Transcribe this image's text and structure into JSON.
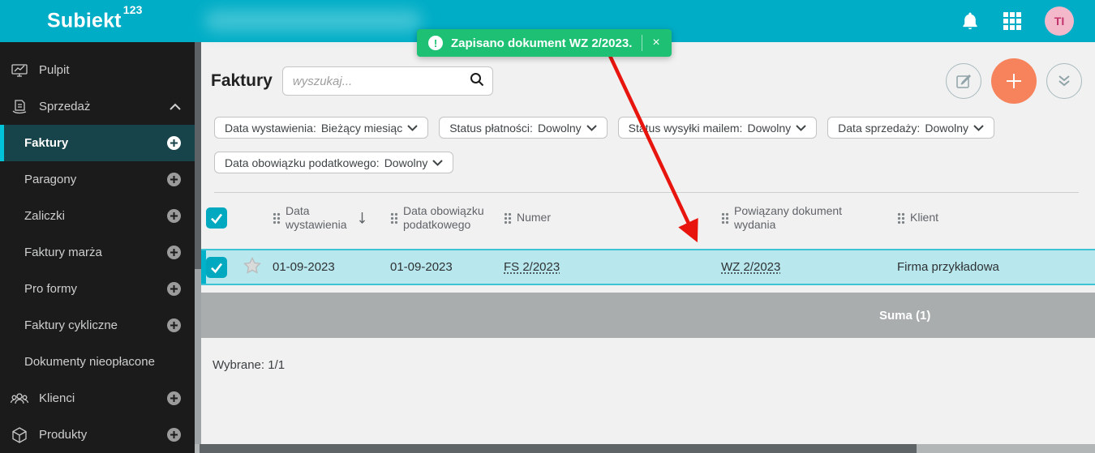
{
  "app": {
    "brand": "Subiekt",
    "brand_sup": "123"
  },
  "topbar": {
    "avatar_initials": "TI"
  },
  "toast": {
    "alert_glyph": "!",
    "message": "Zapisano dokument WZ 2/2023.",
    "close_glyph": "×"
  },
  "sidebar": {
    "items": [
      {
        "label": "Pulpit"
      },
      {
        "label": "Sprzedaż"
      },
      {
        "label": "Faktury"
      },
      {
        "label": "Paragony"
      },
      {
        "label": "Zaliczki"
      },
      {
        "label": "Faktury marża"
      },
      {
        "label": "Pro formy"
      },
      {
        "label": "Faktury cykliczne"
      },
      {
        "label": "Dokumenty nieopłacone"
      },
      {
        "label": "Klienci"
      },
      {
        "label": "Produkty"
      }
    ]
  },
  "main": {
    "title": "Faktury",
    "search": {
      "placeholder": "wyszukaj..."
    },
    "filters_row1": [
      {
        "label": "Data wystawienia:",
        "value": "Bieżący miesiąc"
      },
      {
        "label": "Status płatności:",
        "value": "Dowolny"
      },
      {
        "label": "Status wysyłki mailem:",
        "value": "Dowolny"
      },
      {
        "label": "Data sprzedaży:",
        "value": "Dowolny"
      }
    ],
    "filters_row2": [
      {
        "label": "Data obowiązku podatkowego:",
        "value": "Dowolny"
      }
    ],
    "table": {
      "columns": [
        "Data wystawienia",
        "Data obowiązku podatkowego",
        "Numer",
        "Powiązany dokument wydania",
        "Klient"
      ],
      "row": {
        "issue_date": "01-09-2023",
        "tax_date": "01-09-2023",
        "number": "FS 2/2023",
        "related_doc": "WZ 2/2023",
        "client": "Firma przykładowa"
      },
      "summary": "Suma (1)"
    },
    "selected_info": "Wybrane: 1/1"
  },
  "colors": {
    "topbar_teal": "#00ADC6",
    "toast_green": "#1EC173",
    "accent_cyan": "#00C4DA",
    "add_orange": "#F6835C",
    "row_highlight": "#B9E7EE",
    "summary_gray": "#A9ADAD",
    "arrow_red": "#E8150F"
  }
}
